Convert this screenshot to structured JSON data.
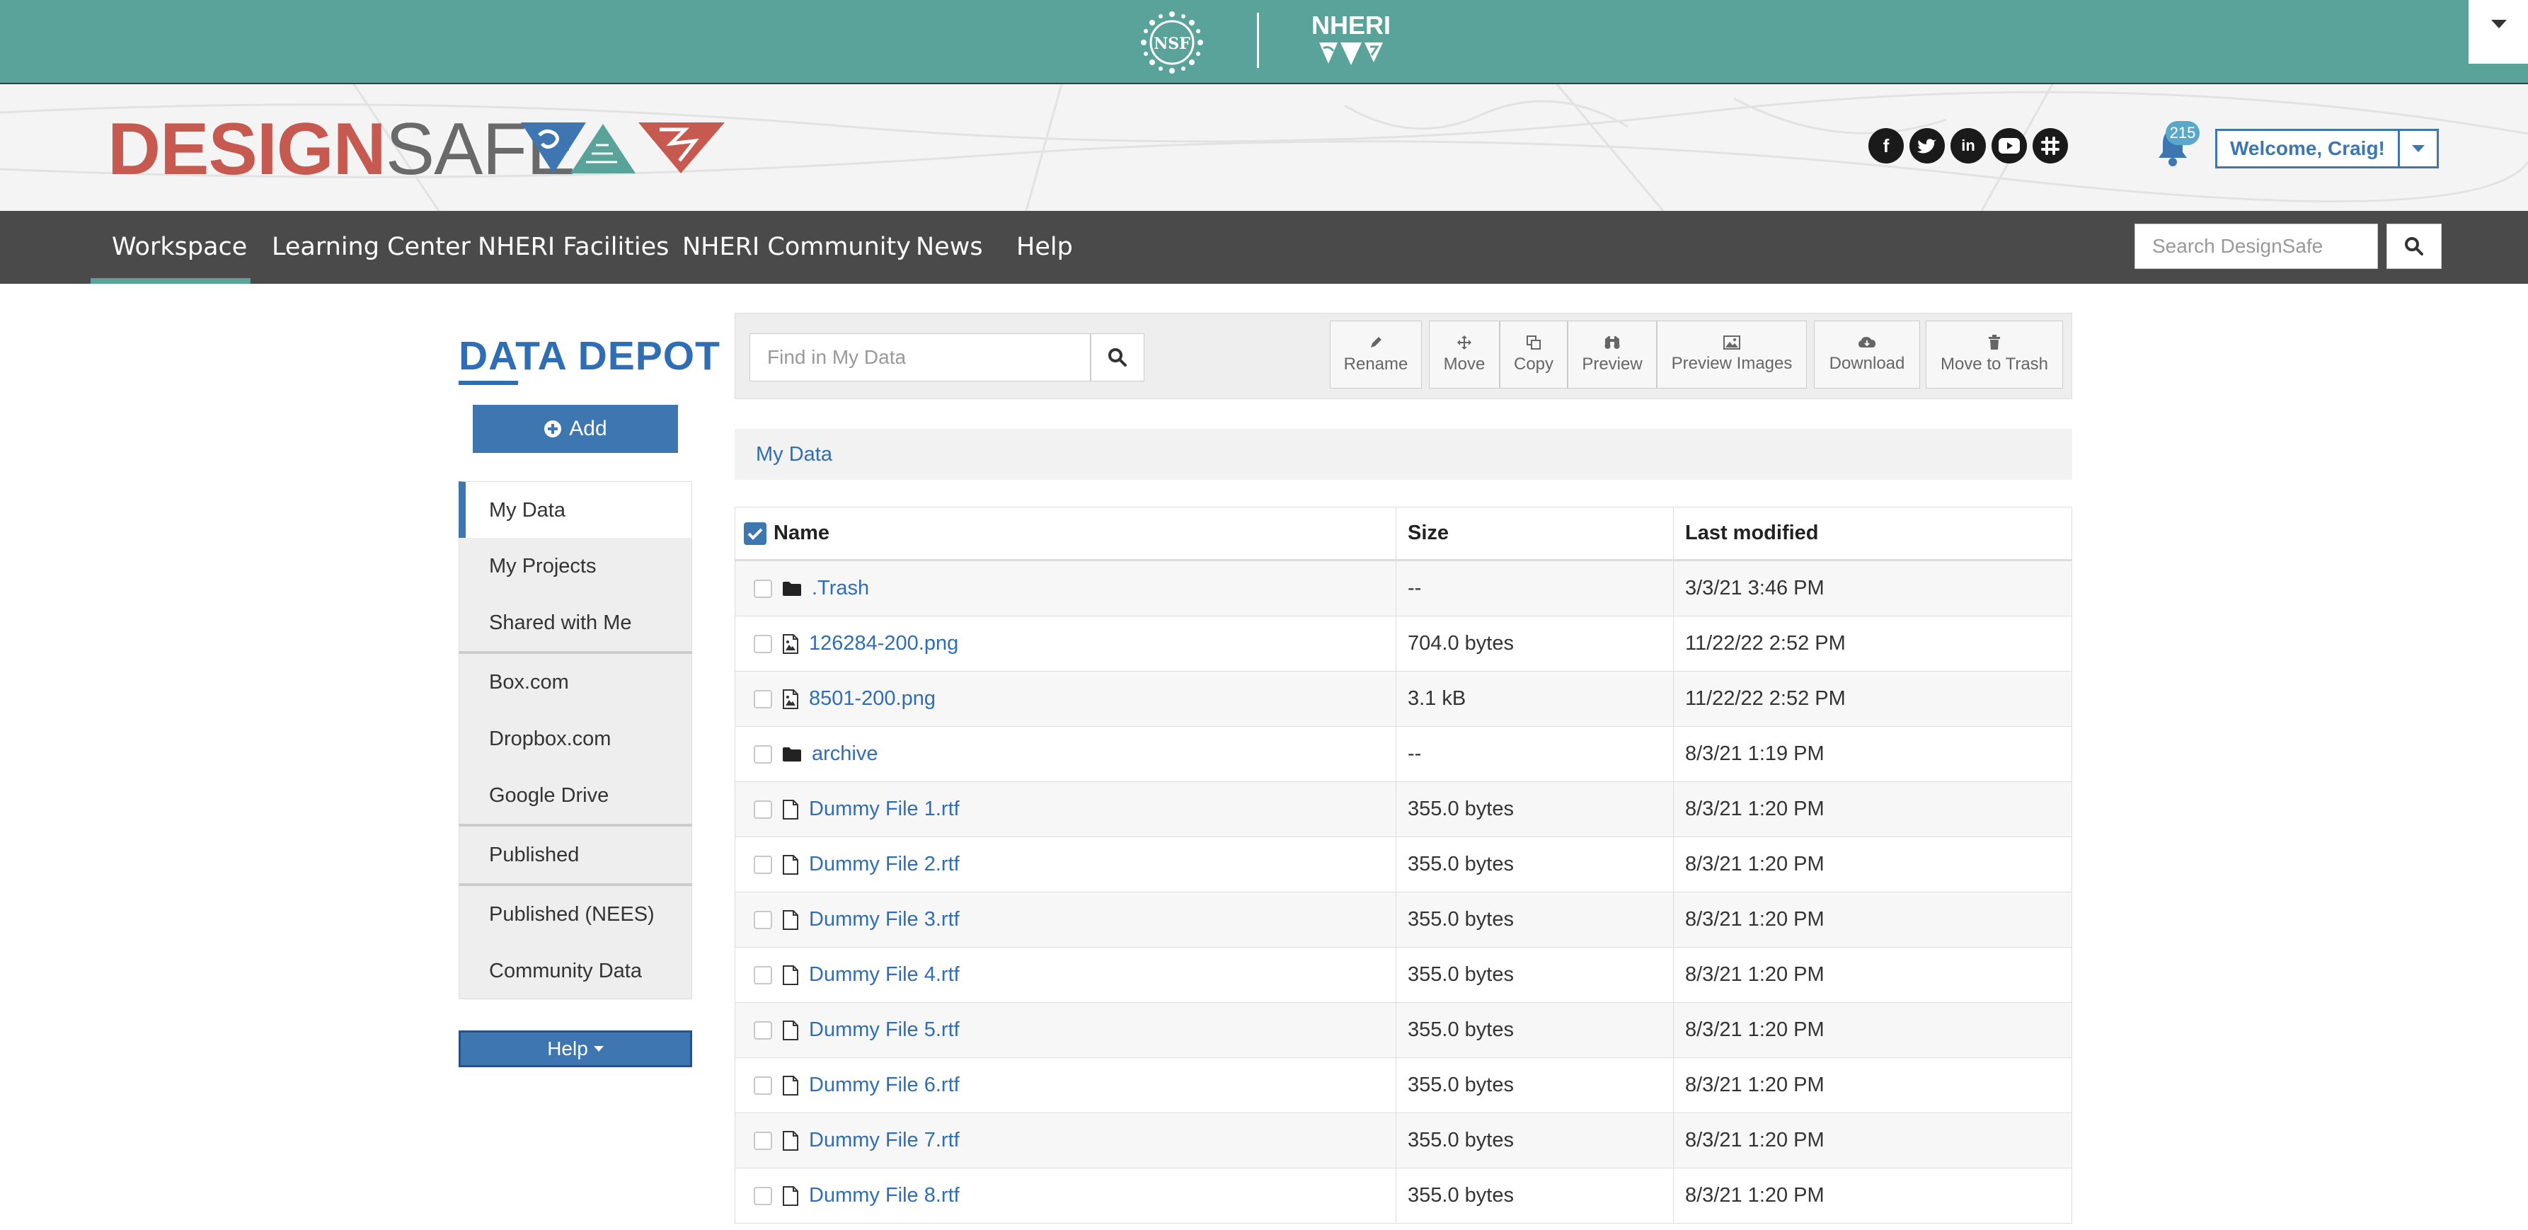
{
  "topbar": {
    "nsf_label": "NSF",
    "nheri_label": "NHERI"
  },
  "header": {
    "logo_design": "DESIGN",
    "logo_safe": "SAFE",
    "notification_count": "215",
    "welcome_label": "Welcome, Craig!",
    "social": [
      "facebook-icon",
      "twitter-icon",
      "linkedin-icon",
      "youtube-icon",
      "slack-icon"
    ]
  },
  "nav": {
    "items": [
      "Workspace",
      "Learning Center",
      "NHERI Facilities",
      "NHERI Community",
      "News",
      "Help"
    ],
    "active": "Workspace",
    "search_placeholder": "Search DesignSafe"
  },
  "sidebar": {
    "title": "DATA DEPOT",
    "add_label": "Add",
    "items": [
      "My Data",
      "My Projects",
      "Shared with Me",
      "Box.com",
      "Dropbox.com",
      "Google Drive",
      "Published",
      "Published (NEES)",
      "Community Data"
    ],
    "active": "My Data",
    "help_label": "Help"
  },
  "toolbar": {
    "find_placeholder": "Find in My Data",
    "buttons": [
      "Rename",
      "Move",
      "Copy",
      "Preview",
      "Preview Images",
      "Download",
      "Move to Trash"
    ]
  },
  "breadcrumb": {
    "current": "My Data"
  },
  "table": {
    "headers": [
      "Name",
      "Size",
      "Last modified"
    ],
    "rows": [
      {
        "name": ".Trash",
        "type": "folder",
        "size": "--",
        "modified": "3/3/21 3:46 PM"
      },
      {
        "name": "126284-200.png",
        "type": "image",
        "size": "704.0 bytes",
        "modified": "11/22/22 2:52 PM"
      },
      {
        "name": "8501-200.png",
        "type": "image",
        "size": "3.1 kB",
        "modified": "11/22/22 2:52 PM"
      },
      {
        "name": "archive",
        "type": "folder",
        "size": "--",
        "modified": "8/3/21 1:19 PM"
      },
      {
        "name": "Dummy File 1.rtf",
        "type": "file",
        "size": "355.0 bytes",
        "modified": "8/3/21 1:20 PM"
      },
      {
        "name": "Dummy File 2.rtf",
        "type": "file",
        "size": "355.0 bytes",
        "modified": "8/3/21 1:20 PM"
      },
      {
        "name": "Dummy File 3.rtf",
        "type": "file",
        "size": "355.0 bytes",
        "modified": "8/3/21 1:20 PM"
      },
      {
        "name": "Dummy File 4.rtf",
        "type": "file",
        "size": "355.0 bytes",
        "modified": "8/3/21 1:20 PM"
      },
      {
        "name": "Dummy File 5.rtf",
        "type": "file",
        "size": "355.0 bytes",
        "modified": "8/3/21 1:20 PM"
      },
      {
        "name": "Dummy File 6.rtf",
        "type": "file",
        "size": "355.0 bytes",
        "modified": "8/3/21 1:20 PM"
      },
      {
        "name": "Dummy File 7.rtf",
        "type": "file",
        "size": "355.0 bytes",
        "modified": "8/3/21 1:20 PM"
      },
      {
        "name": "Dummy File 8.rtf",
        "type": "file",
        "size": "355.0 bytes",
        "modified": "8/3/21 1:20 PM"
      }
    ]
  },
  "colors": {
    "teal": "#5aa39b",
    "nav_bg": "#4a4a4a",
    "primary_blue": "#3d76b0",
    "link_blue": "#2f6db5",
    "logo_red": "#c65a50"
  }
}
